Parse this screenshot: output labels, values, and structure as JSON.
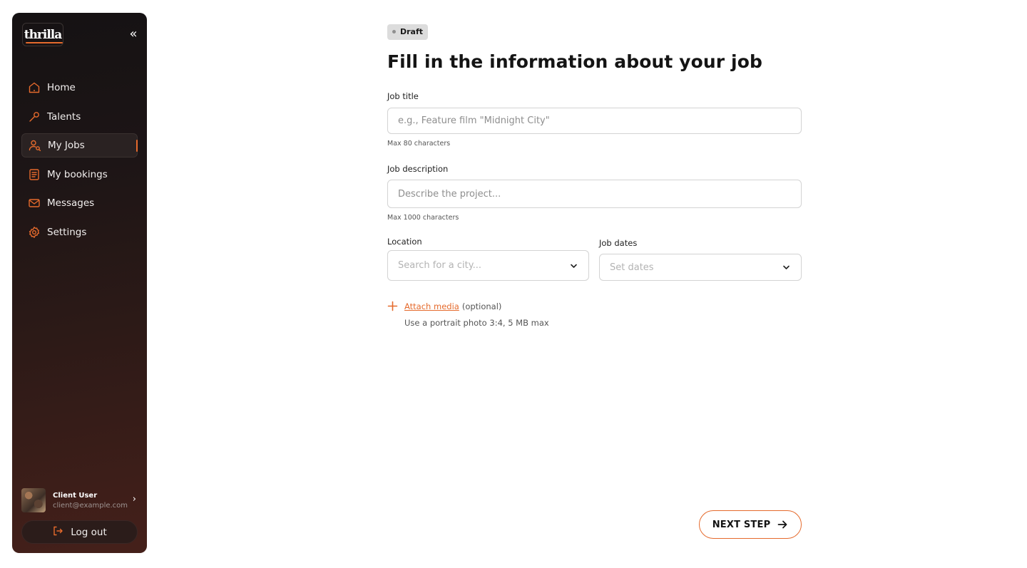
{
  "colors": {
    "accent": "#e56a2c",
    "sidebar_dark": "#151213",
    "sidebar_warm": "#45201a"
  },
  "sidebar": {
    "logo_text": "thrilla",
    "collapse_glyph": "«",
    "items": [
      {
        "label": "Home",
        "icon": "home-icon",
        "active": false
      },
      {
        "label": "Talents",
        "icon": "wrench-icon",
        "active": false
      },
      {
        "label": "My Jobs",
        "icon": "user-search-icon",
        "active": true
      },
      {
        "label": "My bookings",
        "icon": "document-icon",
        "active": false
      },
      {
        "label": "Messages",
        "icon": "mail-icon",
        "active": false
      },
      {
        "label": "Settings",
        "icon": "gear-icon",
        "active": false
      }
    ],
    "user": {
      "name": "Client User",
      "email": "client@example.com"
    },
    "logout_label": "Log out"
  },
  "main": {
    "status_badge": "Draft",
    "title": "Fill in the information about your job",
    "job_title": {
      "label": "Job title",
      "placeholder": "e.g., Feature film \"Midnight City\"",
      "hint": "Max 80 characters"
    },
    "job_description": {
      "label": "Job description",
      "placeholder": "Describe the project...",
      "hint": "Max 1000 characters"
    },
    "location": {
      "label": "Location",
      "placeholder": "Search for a city..."
    },
    "job_dates": {
      "label": "Job dates",
      "placeholder": "Set dates"
    },
    "attach": {
      "link": "Attach media",
      "optional": "(optional)",
      "hint": "Use a portrait photo 3:4, 5 MB max"
    },
    "next_label": "NEXT STEP"
  }
}
